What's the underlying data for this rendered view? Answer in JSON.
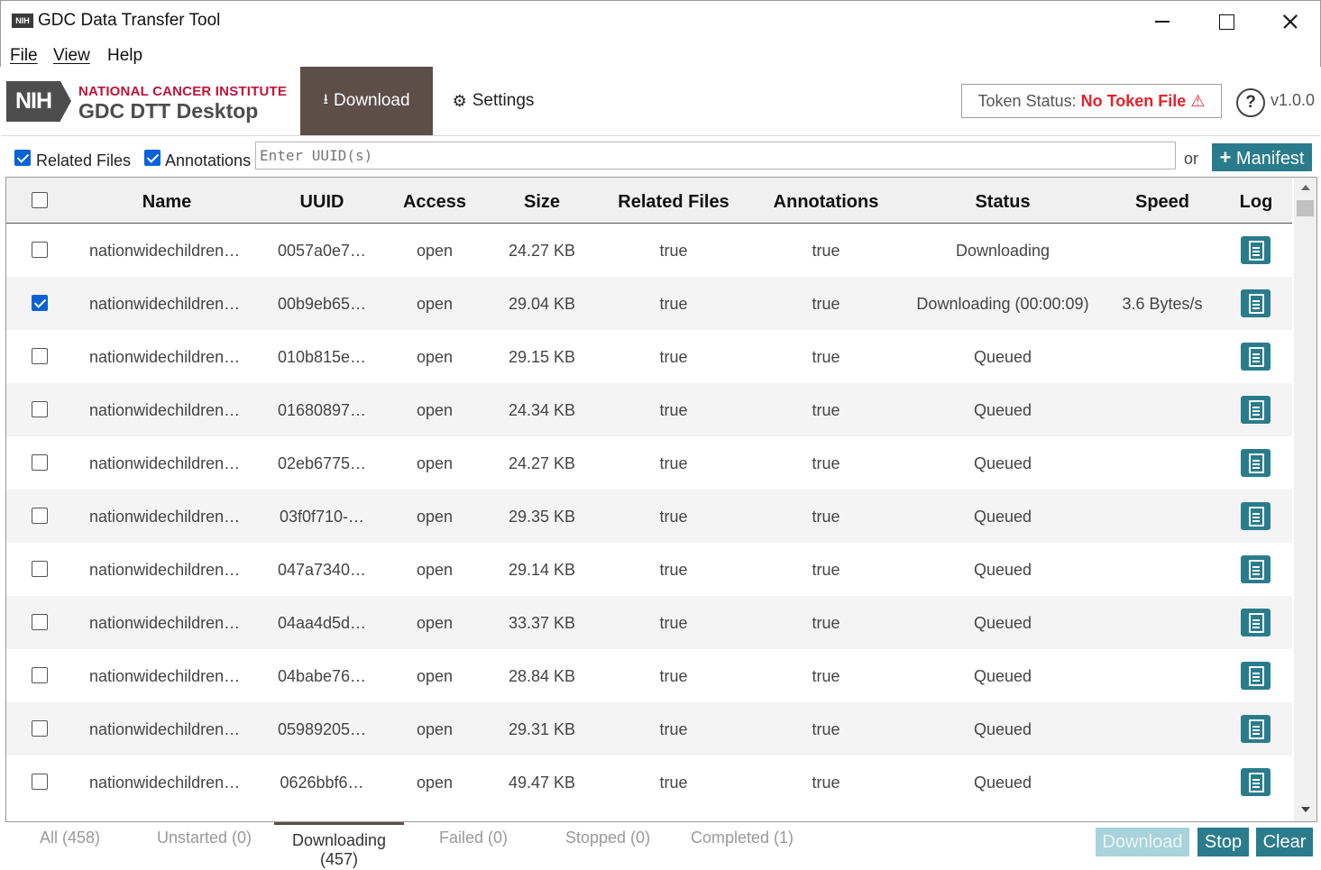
{
  "window": {
    "icon_text": "NIH",
    "title": "GDC Data Transfer Tool"
  },
  "menu": {
    "file": "File",
    "view": "View",
    "help": "Help"
  },
  "header": {
    "logo_nih": "NIH",
    "logo_line1": "NATIONAL CANCER INSTITUTE",
    "logo_line2": "GDC DTT Desktop",
    "tab_download": "Download",
    "tab_settings": "Settings",
    "token_label": "Token Status:",
    "token_value": "No Token File",
    "help_icon": "?",
    "version": "v1.0.0"
  },
  "input_row": {
    "related_files_label": "Related Files",
    "related_files_checked": true,
    "annotations_label": "Annotations",
    "annotations_checked": true,
    "uuid_placeholder": "Enter UUID(s)",
    "or_text": "or",
    "manifest_label": "Manifest"
  },
  "table": {
    "columns": [
      "Name",
      "UUID",
      "Access",
      "Size",
      "Related Files",
      "Annotations",
      "Status",
      "Speed",
      "Log"
    ],
    "rows": [
      {
        "checked": false,
        "name": "nationwidechildren…",
        "uuid": "0057a0e7…",
        "access": "open",
        "size": "24.27 KB",
        "related": "true",
        "annotations": "true",
        "status": "Downloading",
        "speed": ""
      },
      {
        "checked": true,
        "name": "nationwidechildren…",
        "uuid": "00b9eb65…",
        "access": "open",
        "size": "29.04 KB",
        "related": "true",
        "annotations": "true",
        "status": "Downloading (00:00:09)",
        "speed": "3.6 Bytes/s"
      },
      {
        "checked": false,
        "name": "nationwidechildren…",
        "uuid": "010b815e…",
        "access": "open",
        "size": "29.15 KB",
        "related": "true",
        "annotations": "true",
        "status": "Queued",
        "speed": ""
      },
      {
        "checked": false,
        "name": "nationwidechildren…",
        "uuid": "01680897…",
        "access": "open",
        "size": "24.34 KB",
        "related": "true",
        "annotations": "true",
        "status": "Queued",
        "speed": ""
      },
      {
        "checked": false,
        "name": "nationwidechildren…",
        "uuid": "02eb6775…",
        "access": "open",
        "size": "24.27 KB",
        "related": "true",
        "annotations": "true",
        "status": "Queued",
        "speed": ""
      },
      {
        "checked": false,
        "name": "nationwidechildren…",
        "uuid": "03f0f710-…",
        "access": "open",
        "size": "29.35 KB",
        "related": "true",
        "annotations": "true",
        "status": "Queued",
        "speed": ""
      },
      {
        "checked": false,
        "name": "nationwidechildren…",
        "uuid": "047a7340…",
        "access": "open",
        "size": "29.14 KB",
        "related": "true",
        "annotations": "true",
        "status": "Queued",
        "speed": ""
      },
      {
        "checked": false,
        "name": "nationwidechildren…",
        "uuid": "04aa4d5d…",
        "access": "open",
        "size": "33.37 KB",
        "related": "true",
        "annotations": "true",
        "status": "Queued",
        "speed": ""
      },
      {
        "checked": false,
        "name": "nationwidechildren…",
        "uuid": "04babe76…",
        "access": "open",
        "size": "28.84 KB",
        "related": "true",
        "annotations": "true",
        "status": "Queued",
        "speed": ""
      },
      {
        "checked": false,
        "name": "nationwidechildren…",
        "uuid": "05989205…",
        "access": "open",
        "size": "29.31 KB",
        "related": "true",
        "annotations": "true",
        "status": "Queued",
        "speed": ""
      },
      {
        "checked": false,
        "name": "nationwidechildren…",
        "uuid": "0626bbf6…",
        "access": "open",
        "size": "49.47 KB",
        "related": "true",
        "annotations": "true",
        "status": "Queued",
        "speed": ""
      }
    ]
  },
  "bottom_tabs": {
    "all": "All (458)",
    "unstarted": "Unstarted (0)",
    "downloading_line1": "Downloading",
    "downloading_line2": "(457)",
    "failed": "Failed (0)",
    "stopped": "Stopped (0)",
    "completed": "Completed (1)"
  },
  "actions": {
    "download": "Download",
    "stop": "Stop",
    "clear": "Clear"
  },
  "colors": {
    "accent": "#2a7c8c",
    "active_tab": "#5d4e48",
    "token_error": "#e5222b",
    "nci_red": "#c0143c"
  }
}
